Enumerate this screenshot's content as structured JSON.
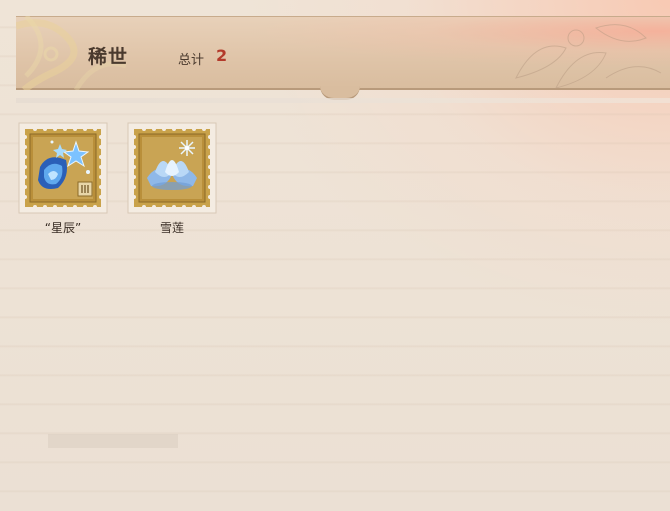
{
  "header": {
    "title": "稀世",
    "total_label": "总计",
    "total_count": "2"
  },
  "items": [
    {
      "label": "“星辰”",
      "icon": "star-crystal-stamp-icon"
    },
    {
      "label": "雪莲",
      "icon": "snow-lotus-stamp-icon"
    }
  ],
  "colors": {
    "header_bg": "#dfc4a8",
    "title_text": "#4a3a2e",
    "count_accent": "#b33a2b",
    "stamp_gold": "#c9a24a"
  }
}
